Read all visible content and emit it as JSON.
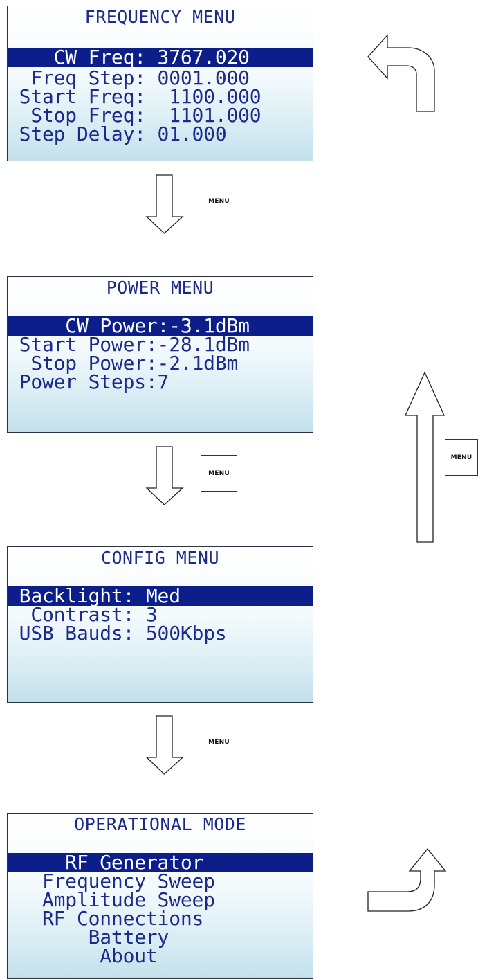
{
  "screens": [
    {
      "title": "FREQUENCY MENU",
      "rows": [
        {
          "text": "    CW Freq: 3767.020",
          "selected": true
        },
        {
          "text": "  Freq Step: 0001.000",
          "selected": false
        },
        {
          "text": " Start Freq:  1100.000",
          "selected": false
        },
        {
          "text": "  Stop Freq:  1101.000",
          "selected": false
        },
        {
          "text": " Step Delay: 01.000",
          "selected": false
        }
      ]
    },
    {
      "title": "POWER MENU",
      "rows": [
        {
          "text": "     CW Power:-3.1dBm",
          "selected": true
        },
        {
          "text": " Start Power:-28.1dBm",
          "selected": false
        },
        {
          "text": "  Stop Power:-2.1dBm",
          "selected": false
        },
        {
          "text": " Power Steps:7",
          "selected": false
        }
      ]
    },
    {
      "title": "CONFIG MENU",
      "rows": [
        {
          "text": " Backlight: Med",
          "selected": true
        },
        {
          "text": "  Contrast: 3",
          "selected": false
        },
        {
          "text": " USB Bauds: 500Kbps",
          "selected": false
        }
      ]
    },
    {
      "title": "OPERATIONAL MODE",
      "rows": [
        {
          "text": "     RF Generator",
          "selected": true
        },
        {
          "text": "   Frequency Sweep",
          "selected": false
        },
        {
          "text": "   Amplitude Sweep",
          "selected": false
        },
        {
          "text": "   RF Connections",
          "selected": false
        },
        {
          "text": "       Battery",
          "selected": false
        },
        {
          "text": "        About",
          "selected": false
        }
      ]
    }
  ],
  "menu_key_label": "MENU"
}
